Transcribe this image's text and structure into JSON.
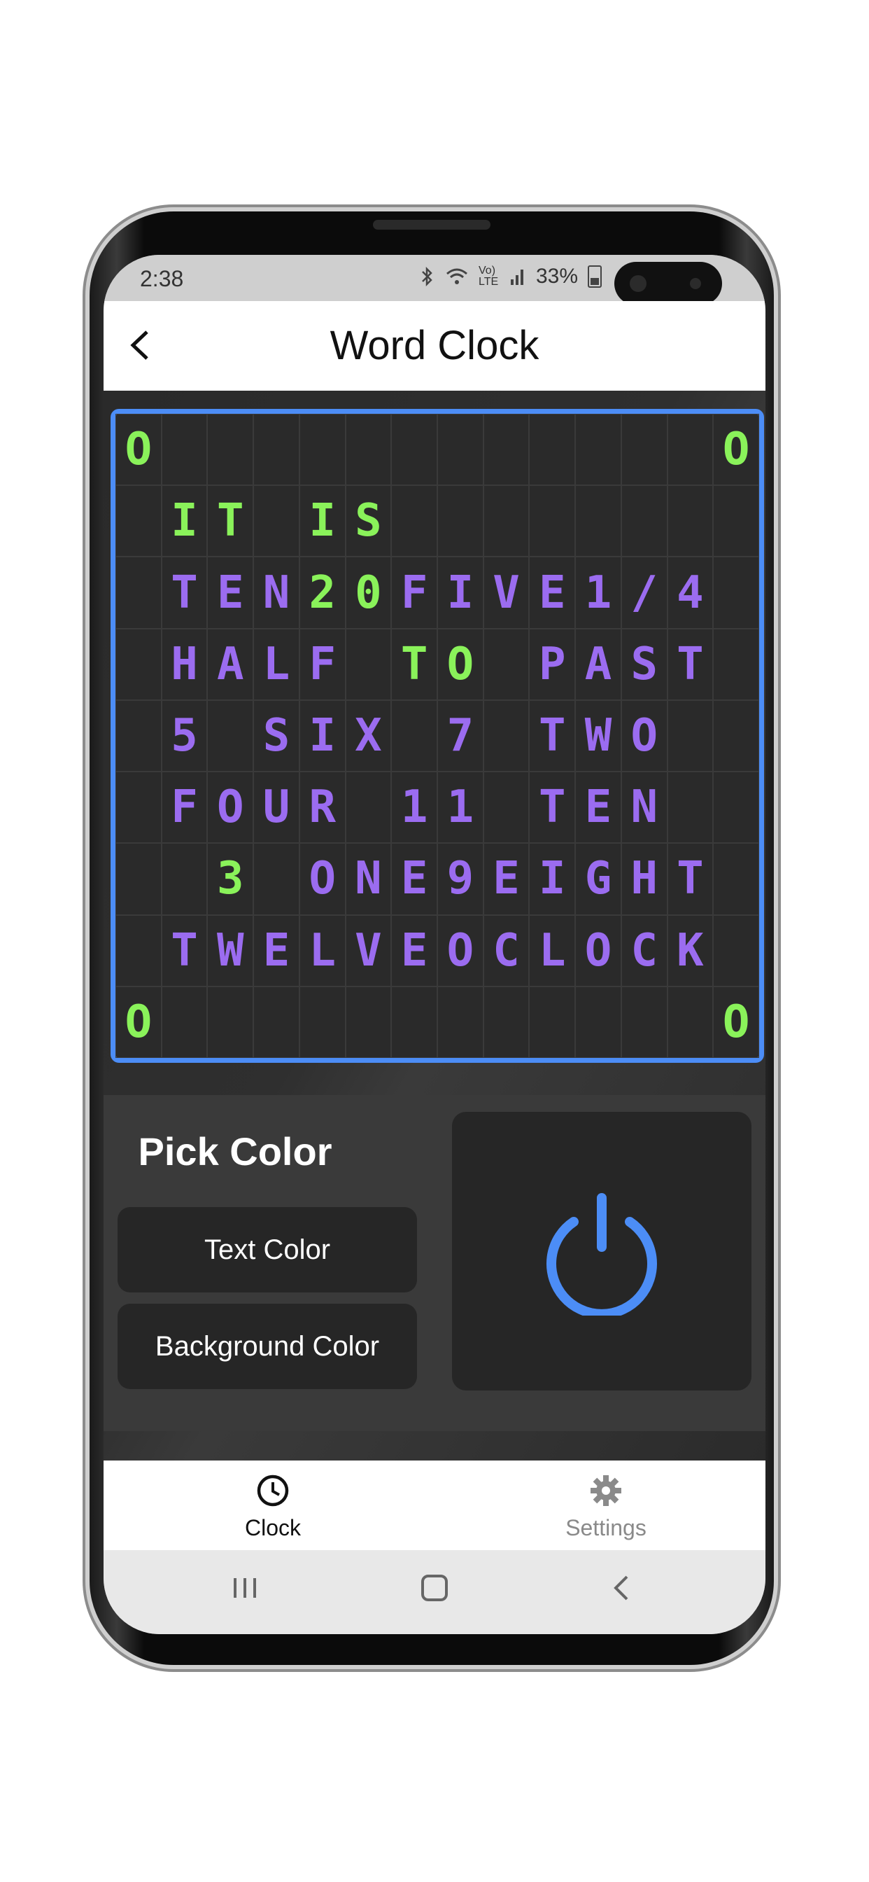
{
  "status_bar": {
    "time": "2:38",
    "network_label": "Vo) LTE",
    "battery": "33%",
    "icons": [
      "bluetooth-icon",
      "wifi-icon",
      "lte-icon",
      "signal-icon",
      "battery-icon"
    ]
  },
  "app_bar": {
    "title": "Word Clock",
    "back_icon": "chevron-left-icon"
  },
  "word_clock": {
    "grid_rows": [
      [
        "O",
        "",
        "",
        "",
        "",
        "",
        "",
        "",
        "",
        "",
        "",
        "",
        "",
        "O"
      ],
      [
        "",
        "I",
        "T",
        "",
        "I",
        "S",
        "",
        "",
        "",
        "",
        "",
        "",
        "",
        ""
      ],
      [
        "",
        "T",
        "E",
        "N",
        "2",
        "0",
        "F",
        "I",
        "V",
        "E",
        "1",
        "/",
        "4",
        ""
      ],
      [
        "",
        "H",
        "A",
        "L",
        "F",
        "",
        "T",
        "O",
        "",
        "P",
        "A",
        "S",
        "T",
        ""
      ],
      [
        "",
        "5",
        "",
        "S",
        "I",
        "X",
        "",
        "7",
        "",
        "T",
        "W",
        "O",
        "",
        ""
      ],
      [
        "",
        "F",
        "O",
        "U",
        "R",
        "",
        "1",
        "1",
        "",
        "T",
        "E",
        "N",
        "",
        ""
      ],
      [
        "",
        "",
        "3",
        "",
        "O",
        "N",
        "E",
        "9",
        "E",
        "I",
        "G",
        "H",
        "T",
        ""
      ],
      [
        "",
        "T",
        "W",
        "E",
        "L",
        "V",
        "E",
        "O",
        "C",
        "L",
        "O",
        "C",
        "K",
        ""
      ],
      [
        "O",
        "",
        "",
        "",
        "",
        "",
        "",
        "",
        "",
        "",
        "",
        "",
        "",
        "O"
      ]
    ],
    "lit_cells": [
      [
        0,
        0
      ],
      [
        0,
        13
      ],
      [
        1,
        1
      ],
      [
        1,
        2
      ],
      [
        1,
        4
      ],
      [
        1,
        5
      ],
      [
        2,
        4
      ],
      [
        2,
        5
      ],
      [
        3,
        6
      ],
      [
        3,
        7
      ],
      [
        6,
        2
      ],
      [
        8,
        0
      ],
      [
        8,
        13
      ]
    ],
    "colors": {
      "lit": "#8af25a",
      "unlit": "#9b6cf0",
      "border": "#4c8df6",
      "background": "#262626"
    }
  },
  "controls": {
    "pick_color_title": "Pick Color",
    "text_color_button": "Text Color",
    "background_color_button": "Background Color",
    "power_icon": "power-icon",
    "power_color": "#4c8df6"
  },
  "bottom_nav": {
    "items": [
      {
        "label": "Clock",
        "icon": "clock-icon",
        "active": true
      },
      {
        "label": "Settings",
        "icon": "gear-icon",
        "active": false
      }
    ]
  },
  "system_nav": [
    "recents-icon",
    "home-icon",
    "back-icon"
  ]
}
